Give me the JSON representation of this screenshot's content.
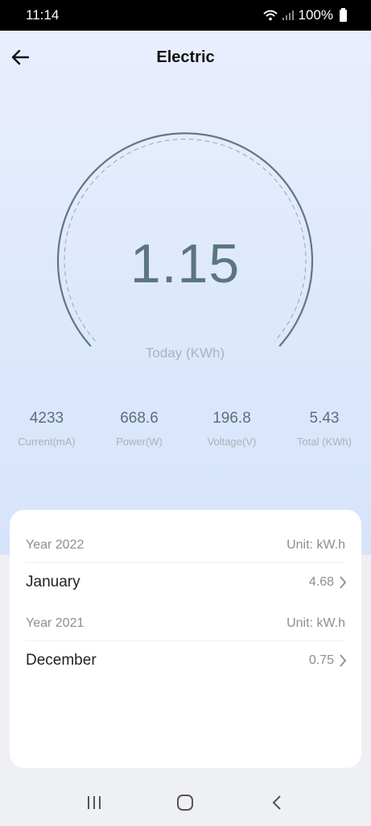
{
  "status": {
    "time": "11:14",
    "battery": "100%"
  },
  "header": {
    "title": "Electric"
  },
  "gauge": {
    "value": "1.15",
    "label": "Today (KWh)"
  },
  "stats": [
    {
      "value": "4233",
      "label": "Current(mA)"
    },
    {
      "value": "668.6",
      "label": "Power(W)"
    },
    {
      "value": "196.8",
      "label": "Voltage(V)"
    },
    {
      "value": "5.43",
      "label": "Total (KWh)"
    }
  ],
  "history": [
    {
      "year": "Year 2022",
      "unit": "Unit: kW.h",
      "month": "January",
      "value": "4.68"
    },
    {
      "year": "Year 2021",
      "unit": "Unit: kW.h",
      "month": "December",
      "value": "0.75"
    }
  ],
  "colors": {
    "accent": "#5c7680",
    "background_top": "#e9eefe",
    "background_bottom": "#d6e4fb"
  },
  "icons": {
    "back": "arrow-left-icon",
    "chevron": "chevron-right-icon",
    "recent": "recent-apps-icon",
    "home": "home-icon",
    "nav_back": "nav-back-icon"
  }
}
